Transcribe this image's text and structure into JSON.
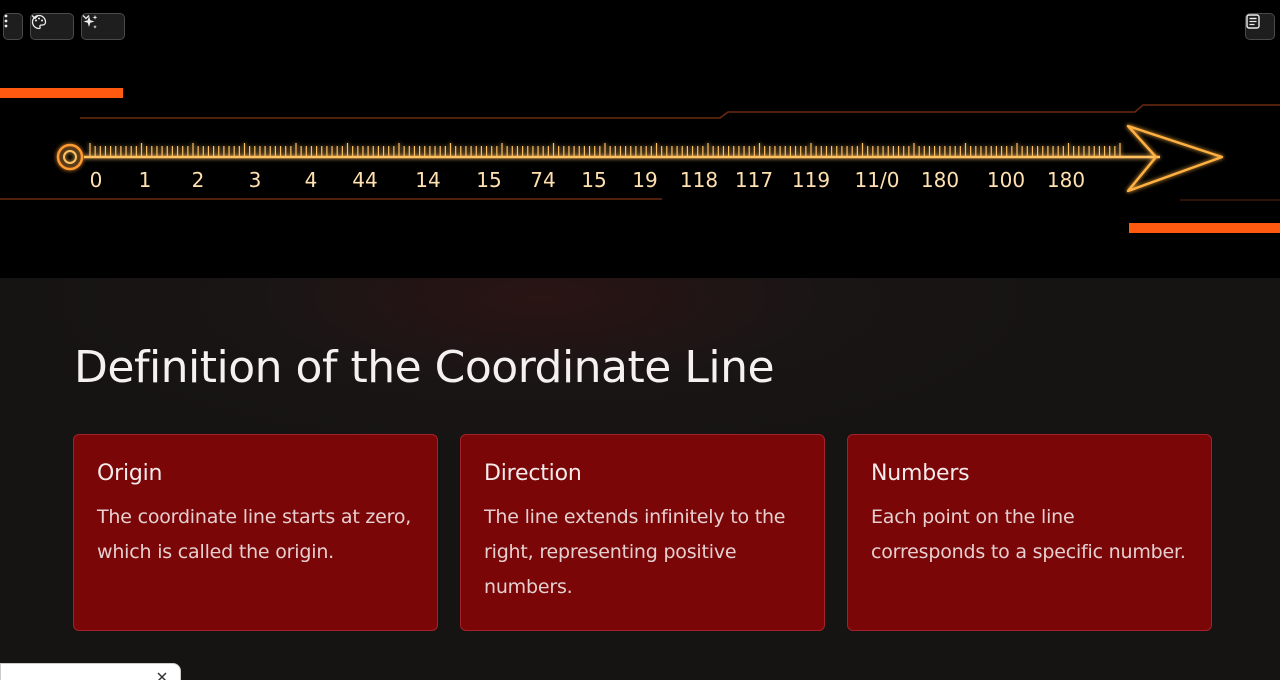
{
  "toolbar": {
    "more_icon": "vertical-ellipsis-icon",
    "theme_icon": "palette-icon",
    "ai_icon": "sparkles-icon",
    "notes_icon": "notes-icon",
    "chevron_icon": "chevron-down-icon"
  },
  "number_line": {
    "labels": [
      "0",
      "1",
      "2",
      "3",
      "4",
      "44",
      "14",
      "15",
      "74",
      "15",
      "19",
      "118",
      "117",
      "119",
      "11/0",
      "180",
      "100",
      "180"
    ],
    "colors": {
      "glow": "#ff6a1a",
      "line": "#ffc060",
      "accent_bar": "#ff5a10",
      "label": "#ffe0b0"
    }
  },
  "slide": {
    "title": "Definition of the Coordinate Line",
    "cards": [
      {
        "heading": "Origin",
        "body": "The coordinate line starts at zero, which is called the origin."
      },
      {
        "heading": "Direction",
        "body": "The line extends infinitely to the right, representing positive numbers."
      },
      {
        "heading": "Numbers",
        "body": "Each point on the line corresponds to a specific number."
      }
    ]
  },
  "toast": {
    "close_icon": "close-icon"
  },
  "colors": {
    "card_bg": "#7a0608",
    "card_border": "#a3222a",
    "page_bg": "#151313"
  }
}
